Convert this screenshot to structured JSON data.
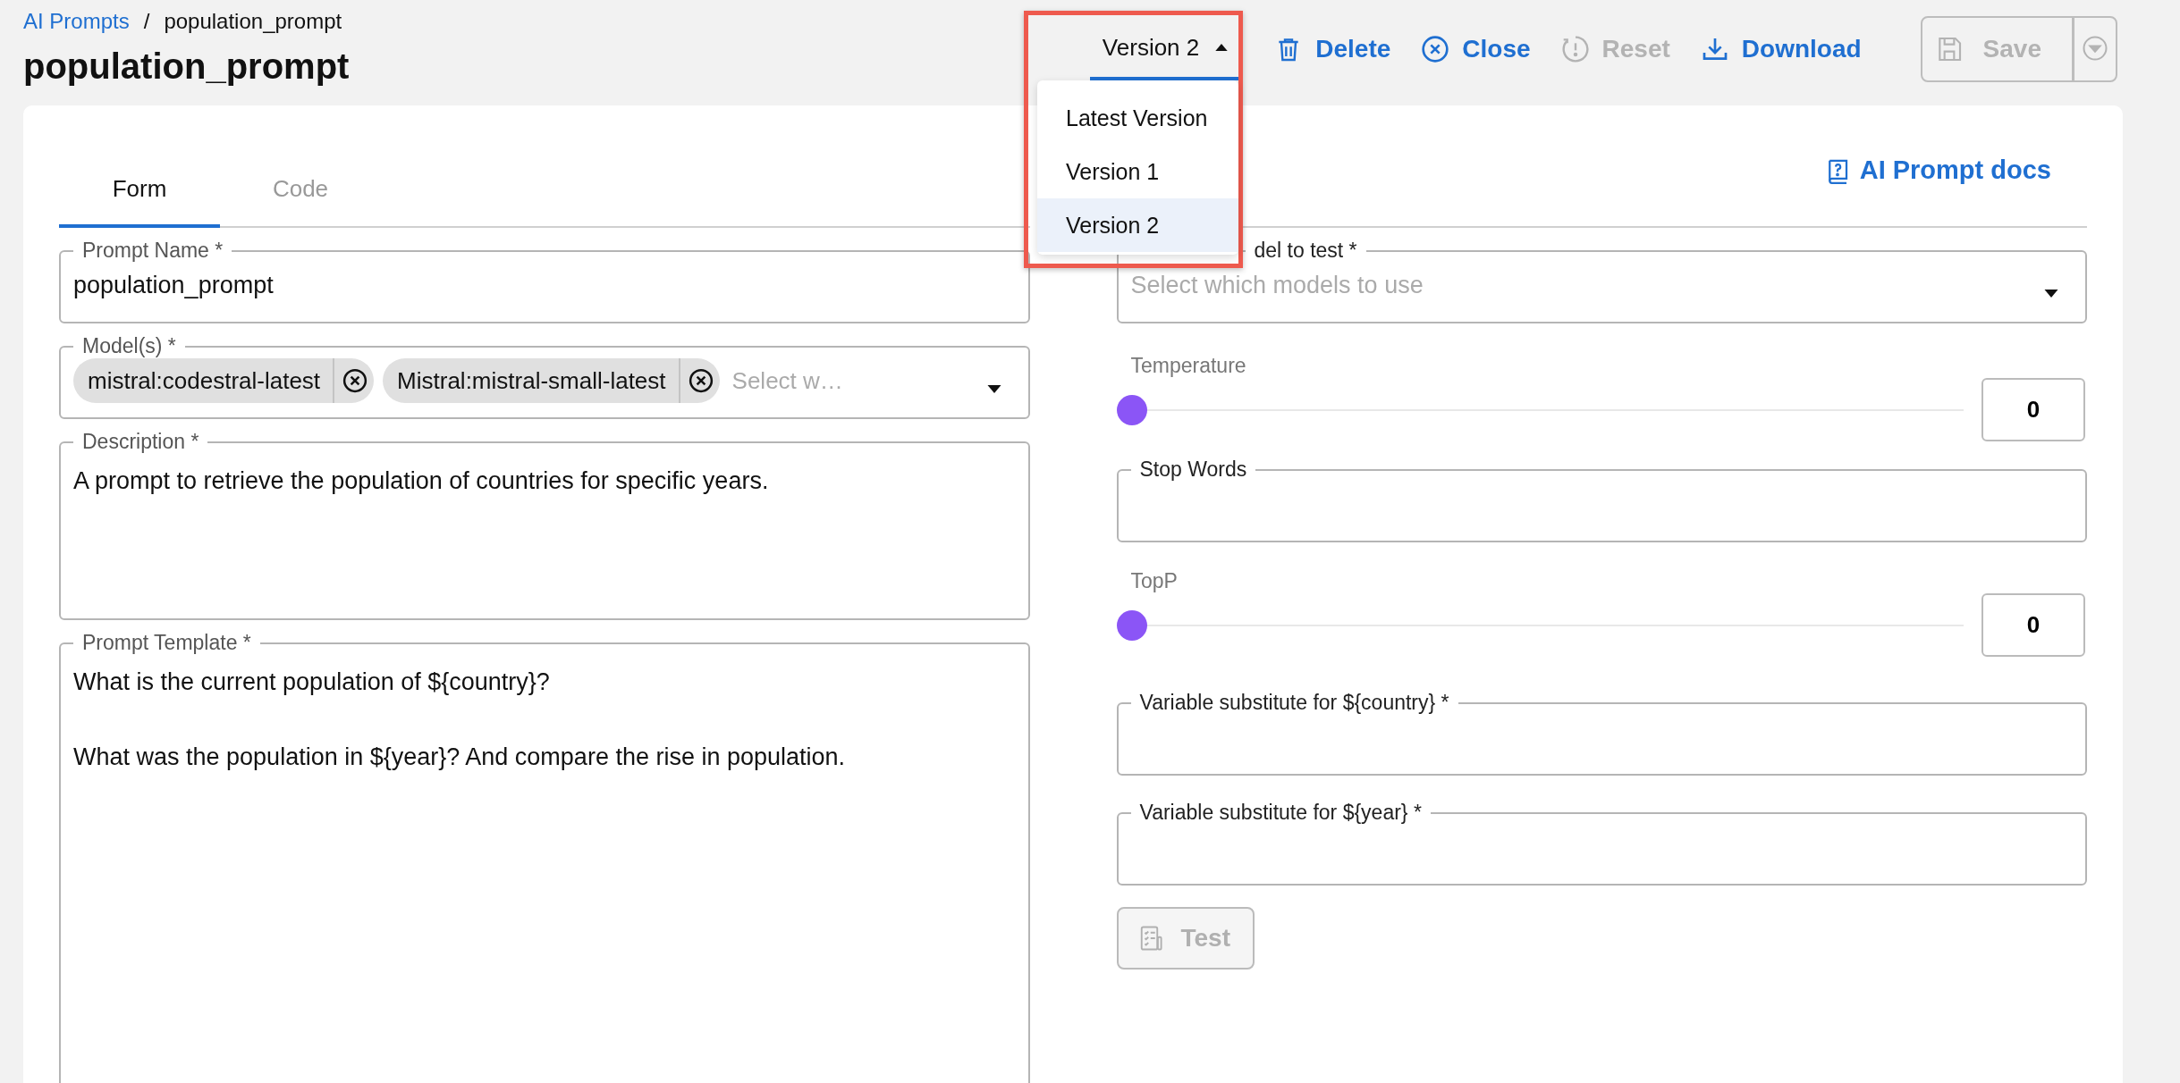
{
  "breadcrumb": {
    "parent": "AI Prompts",
    "separator": "/",
    "current": "population_prompt"
  },
  "title": "population_prompt",
  "toolbar": {
    "version_select": {
      "value": "Version 2",
      "expanded": true
    },
    "actions": [
      {
        "label": "Delete",
        "kind": "delete",
        "disabled": false
      },
      {
        "label": "Close",
        "kind": "close",
        "disabled": false
      },
      {
        "label": "Reset",
        "kind": "reset",
        "disabled": true
      },
      {
        "label": "Download",
        "kind": "download",
        "disabled": false
      }
    ],
    "save": {
      "label": "Save",
      "disabled": true
    }
  },
  "version_menu": {
    "highlighted": true,
    "options": [
      {
        "label": "Latest Version",
        "selected": false
      },
      {
        "label": "Version 1",
        "selected": false
      },
      {
        "label": "Version 2",
        "selected": true
      }
    ]
  },
  "tabs": [
    {
      "label": "Form",
      "selected": true
    },
    {
      "label": "Code",
      "selected": false
    }
  ],
  "docs_link": "AI Prompt docs",
  "form": {
    "prompt_name": {
      "label": "Prompt Name *",
      "value": "population_prompt"
    },
    "models": {
      "label": "Model(s) *",
      "chips": [
        "mistral:codestral-latest",
        "Mistral:mistral-small-latest"
      ],
      "placeholder": "Select w…"
    },
    "description": {
      "label": "Description *",
      "value": "A prompt to retrieve the population of countries for specific years."
    },
    "prompt_template": {
      "label": "Prompt Template *",
      "value": "What is the current population of ${country}?\n\nWhat was the population in ${year}? And compare the rise in population."
    }
  },
  "test_panel": {
    "model_select": {
      "label": "del to test *",
      "placeholder": "Select which models to use"
    },
    "temperature": {
      "label": "Temperature",
      "level": 0,
      "value": "0"
    },
    "stop_words": {
      "label": "Stop Words"
    },
    "top_p": {
      "label": "TopP",
      "level": 0,
      "value": "0"
    },
    "variables": [
      {
        "label": "Variable substitute for ${country} *"
      },
      {
        "label": "Variable substitute for ${year} *"
      }
    ],
    "test_button": {
      "label": "Test",
      "disabled": true
    }
  }
}
